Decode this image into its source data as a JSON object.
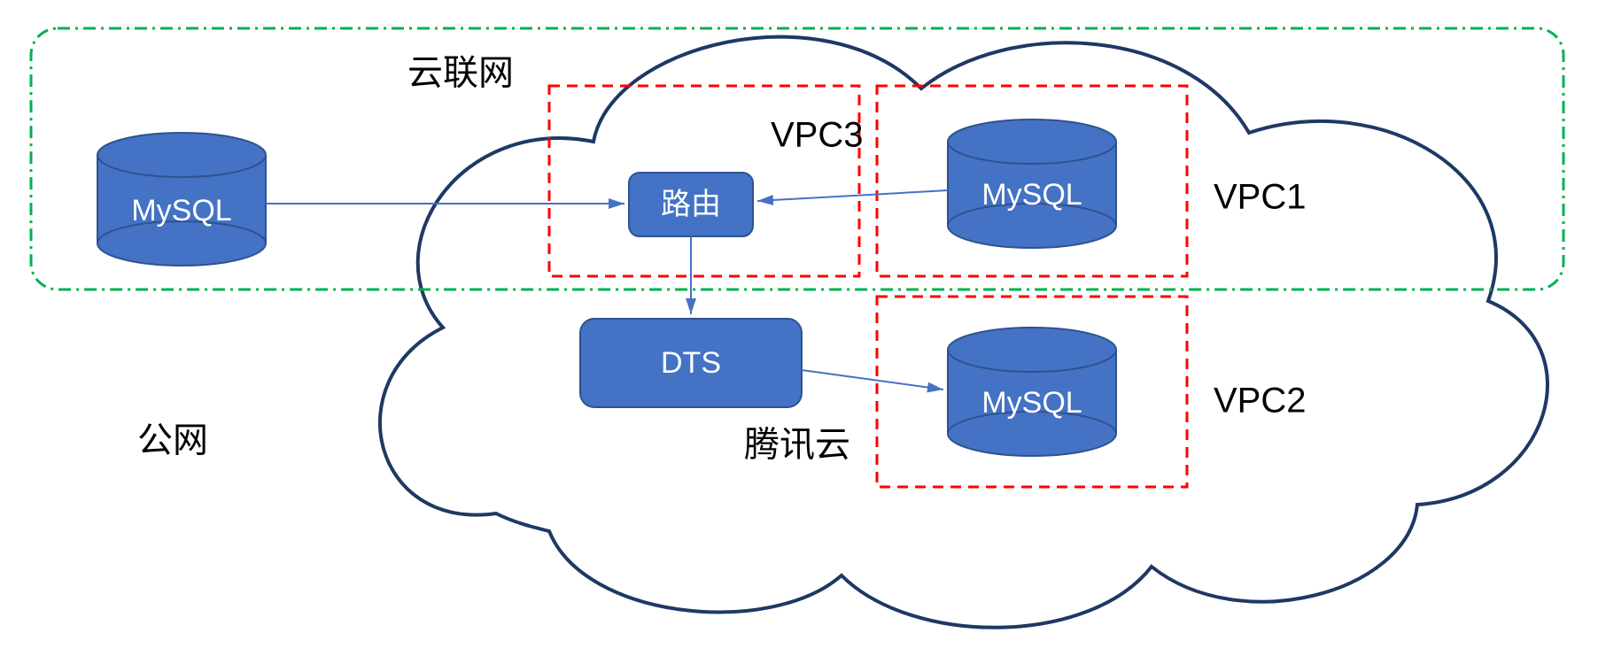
{
  "labels": {
    "ccn": "云联网",
    "vpc3": "VPC3",
    "vpc1": "VPC1",
    "vpc2": "VPC2",
    "public_network": "公网",
    "tencent_cloud": "腾讯云"
  },
  "nodes": {
    "mysql_left": "MySQL",
    "mysql_right_top": "MySQL",
    "mysql_right_bottom": "MySQL",
    "router": "路由",
    "dts": "DTS"
  },
  "colors": {
    "node_fill": "#4472C4",
    "node_stroke": "#2F528F",
    "cloud_stroke": "#1F3864",
    "green_dash": "#00B050",
    "red_dash": "#FF0000",
    "arrow": "#4472C4"
  }
}
